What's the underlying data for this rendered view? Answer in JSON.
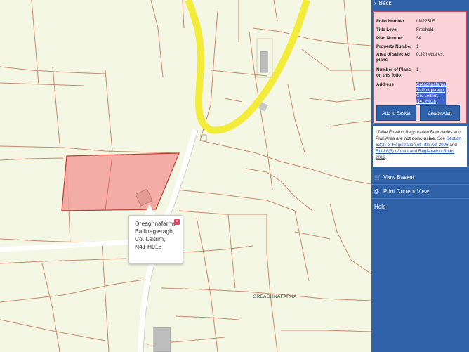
{
  "map": {
    "callout_lines": [
      "Greaghnafarna,",
      "Ballinagleragh,",
      "Co. Leitrim,",
      "N41 H018"
    ],
    "townland_label": "GREAGHNAFARNA",
    "colors": {
      "parcel_fill": "#f4a39e",
      "parcel_border": "#c0392b",
      "regional_road": "#f4ec3a",
      "local_road": "#ffffff",
      "boundary_line": "#c98a6c"
    }
  },
  "sidebar": {
    "back_label": "Back",
    "info": {
      "rows": [
        {
          "label": "Folio Number",
          "value": "LM2251F"
        },
        {
          "label": "Title Level",
          "value": "Freehold"
        },
        {
          "label": "Plan Number",
          "value": "54"
        },
        {
          "label": "Property Number",
          "value": "1"
        },
        {
          "label": "Area of selected plans",
          "value": "0.32 hectares."
        },
        {
          "label": "Number of Plans on this folio:",
          "value": "1"
        },
        {
          "label": "Address",
          "value": "Greaghnafarna, Ballinagleragh, Co. Leitrim, N41 H018"
        }
      ],
      "add_to_basket_label": "Add to Basket",
      "create_alert_label": "Create Alert"
    },
    "note": {
      "prefix": "*Tailte Éireann Registration Boundaries and Plan Area ",
      "bold": "are not conclusive",
      "mid": ". See ",
      "link1": "Section 62(2) of Registration of Title Act 2006",
      "and": " and ",
      "link2": "Rule 8(3) of the Land Registration Rules 2012",
      "suffix": "."
    },
    "menu": [
      {
        "label": "View Basket",
        "icon": "cart-icon"
      },
      {
        "label": "Print Current View",
        "icon": "print-icon"
      },
      {
        "label": "Help",
        "icon": ""
      }
    ],
    "colors": {
      "sidebar_bg": "#2f61a8",
      "panel_bg": "#f9d3d7",
      "address_highlight": "#3b63c8"
    }
  }
}
